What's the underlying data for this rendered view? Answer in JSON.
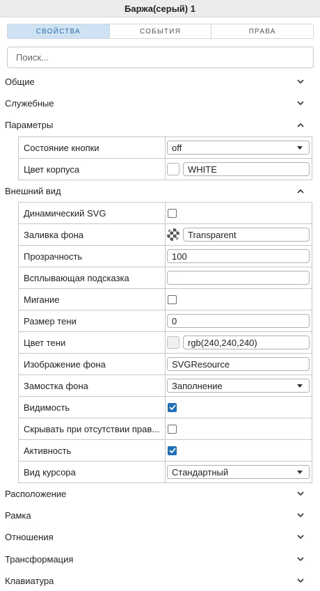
{
  "window": {
    "title": "Баржа(серый) 1"
  },
  "tabs": [
    {
      "label": "СВОЙСТВА",
      "active": true
    },
    {
      "label": "СОБЫТИЯ",
      "active": false
    },
    {
      "label": "ПРАВА",
      "active": false
    }
  ],
  "search": {
    "placeholder": "Поиск..."
  },
  "sections": {
    "general": {
      "label": "Общие",
      "expanded": false
    },
    "service": {
      "label": "Служебные",
      "expanded": false
    },
    "params": {
      "label": "Параметры",
      "expanded": true
    },
    "appearance": {
      "label": "Внешний вид",
      "expanded": true
    },
    "location": {
      "label": "Расположение",
      "expanded": false
    },
    "frame": {
      "label": "Рамка",
      "expanded": false
    },
    "relations": {
      "label": "Отношения",
      "expanded": false
    },
    "transform": {
      "label": "Трансформация",
      "expanded": false
    },
    "keyboard": {
      "label": "Клавиатура",
      "expanded": false
    }
  },
  "params_rows": {
    "button_state": {
      "label": "Состояние кнопки",
      "value": "off"
    },
    "body_color": {
      "label": "Цвет корпуса",
      "value": "WHITE",
      "swatch": "#ffffff"
    }
  },
  "appearance_rows": {
    "dynamic_svg": {
      "label": "Динамический SVG",
      "checked": false
    },
    "bg_fill": {
      "label": "Заливка фона",
      "value": "Transparent"
    },
    "opacity": {
      "label": "Прозрачность",
      "value": "100"
    },
    "tooltip": {
      "label": "Всплывающая подсказка",
      "value": ""
    },
    "blink": {
      "label": "Мигание",
      "checked": false
    },
    "shadow_size": {
      "label": "Размер тени",
      "value": "0"
    },
    "shadow_color": {
      "label": "Цвет тени",
      "value": "rgb(240,240,240)",
      "swatch": "#f0f0f0"
    },
    "bg_image": {
      "label": "Изображение фона",
      "value": "SVGResource"
    },
    "bg_tiling": {
      "label": "Замостка фона",
      "value": "Заполнение"
    },
    "visible": {
      "label": "Видимость",
      "checked": true
    },
    "hide_no_rights": {
      "label": "Скрывать при отсутствии прав...",
      "checked": false
    },
    "active": {
      "label": "Активность",
      "checked": true
    },
    "cursor": {
      "label": "Вид курсора",
      "value": "Стандартный"
    }
  },
  "colors": {
    "accent": "#1f6fb8",
    "tab_active_bg": "#cfe2f3",
    "title_bg": "#ececec"
  }
}
